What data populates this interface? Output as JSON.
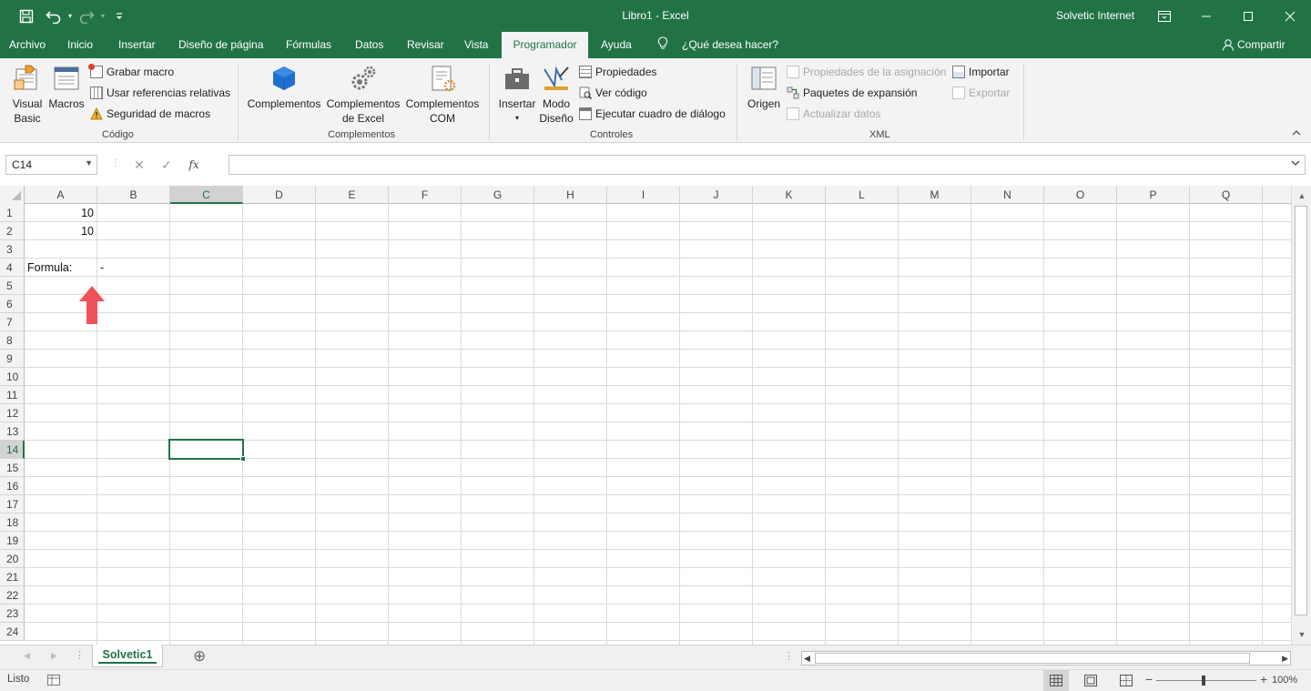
{
  "window": {
    "title": "Libro1  -  Excel",
    "user": "Solvetic Internet",
    "accent": "#217346"
  },
  "quick_access": [
    {
      "icon": "save-icon"
    },
    {
      "icon": "undo-icon"
    },
    {
      "icon": "redo-icon"
    },
    {
      "icon": "customize-qat-icon"
    }
  ],
  "tabs": [
    "Archivo",
    "Inicio",
    "Insertar",
    "Diseño de página",
    "Fórmulas",
    "Datos",
    "Revisar",
    "Vista",
    "Programador",
    "Ayuda"
  ],
  "active_tab": "Programador",
  "tell_me": "¿Qué desea hacer?",
  "share": "Compartir",
  "ribbon": {
    "codigo": {
      "label": "Código",
      "visual_basic": [
        "Visual",
        "Basic"
      ],
      "macros": "Macros",
      "grabar_macro": "Grabar macro",
      "usar_referencias": "Usar referencias relativas",
      "seguridad": "Seguridad de macros"
    },
    "complementos": {
      "label": "Complementos",
      "complementos": "Complementos",
      "excel": [
        "Complementos",
        "de Excel"
      ],
      "com": [
        "Complementos",
        "COM"
      ]
    },
    "controles": {
      "label": "Controles",
      "insertar": "Insertar",
      "modo_diseno": [
        "Modo",
        "Diseño"
      ],
      "propiedades": "Propiedades",
      "ver_codigo": "Ver código",
      "ejecutar": "Ejecutar cuadro de diálogo"
    },
    "xml": {
      "label": "XML",
      "origen": "Origen",
      "propiedades_asignacion": "Propiedades de la asignación",
      "paquetes": "Paquetes de expansión",
      "actualizar": "Actualizar datos",
      "importar": "Importar",
      "exportar": "Exportar"
    }
  },
  "formula_bar": {
    "name_box": "C14",
    "cancel": "✕",
    "enter": "✓",
    "fx": "fx",
    "value": ""
  },
  "grid": {
    "columns": [
      "A",
      "B",
      "C",
      "D",
      "E",
      "F",
      "G",
      "H",
      "I",
      "J",
      "K",
      "L",
      "M",
      "N",
      "O",
      "P",
      "Q"
    ],
    "rows": [
      "1",
      "2",
      "3",
      "4",
      "5",
      "6",
      "7",
      "8",
      "9",
      "10",
      "11",
      "12",
      "13",
      "14",
      "15",
      "16",
      "17",
      "18",
      "19",
      "20",
      "21",
      "22",
      "23",
      "24"
    ],
    "selected_column": "C",
    "selected_row": "14",
    "cells": {
      "A1": "10",
      "A2": "10",
      "A4": "Formula:",
      "B4": "-"
    }
  },
  "sheet": {
    "tab": "Solvetic1",
    "add": "⊕"
  },
  "status": {
    "ready": "Listo",
    "zoom": "100%"
  }
}
